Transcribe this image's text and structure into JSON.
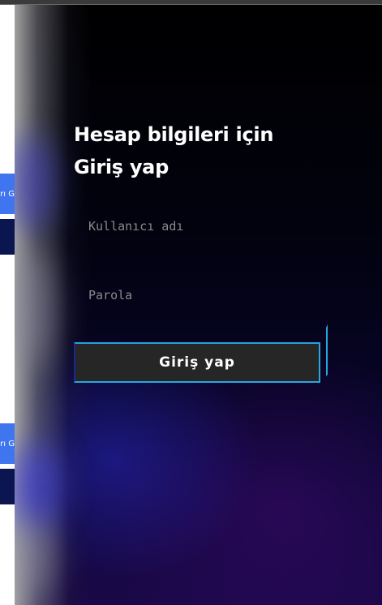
{
  "background_page": {
    "button_fragment_1": "arı G",
    "button_fragment_2": "arı G"
  },
  "login_panel": {
    "title_line1": "Hesap bilgileri için",
    "title_line2": "Giriş yap",
    "username_placeholder": "Kullanıcı adı",
    "password_placeholder": "Parola",
    "submit_label": "Giriş yap"
  },
  "colors": {
    "accent_border": "#2aa6df",
    "button_bg": "#262626",
    "background_button": "#3f76f0"
  }
}
